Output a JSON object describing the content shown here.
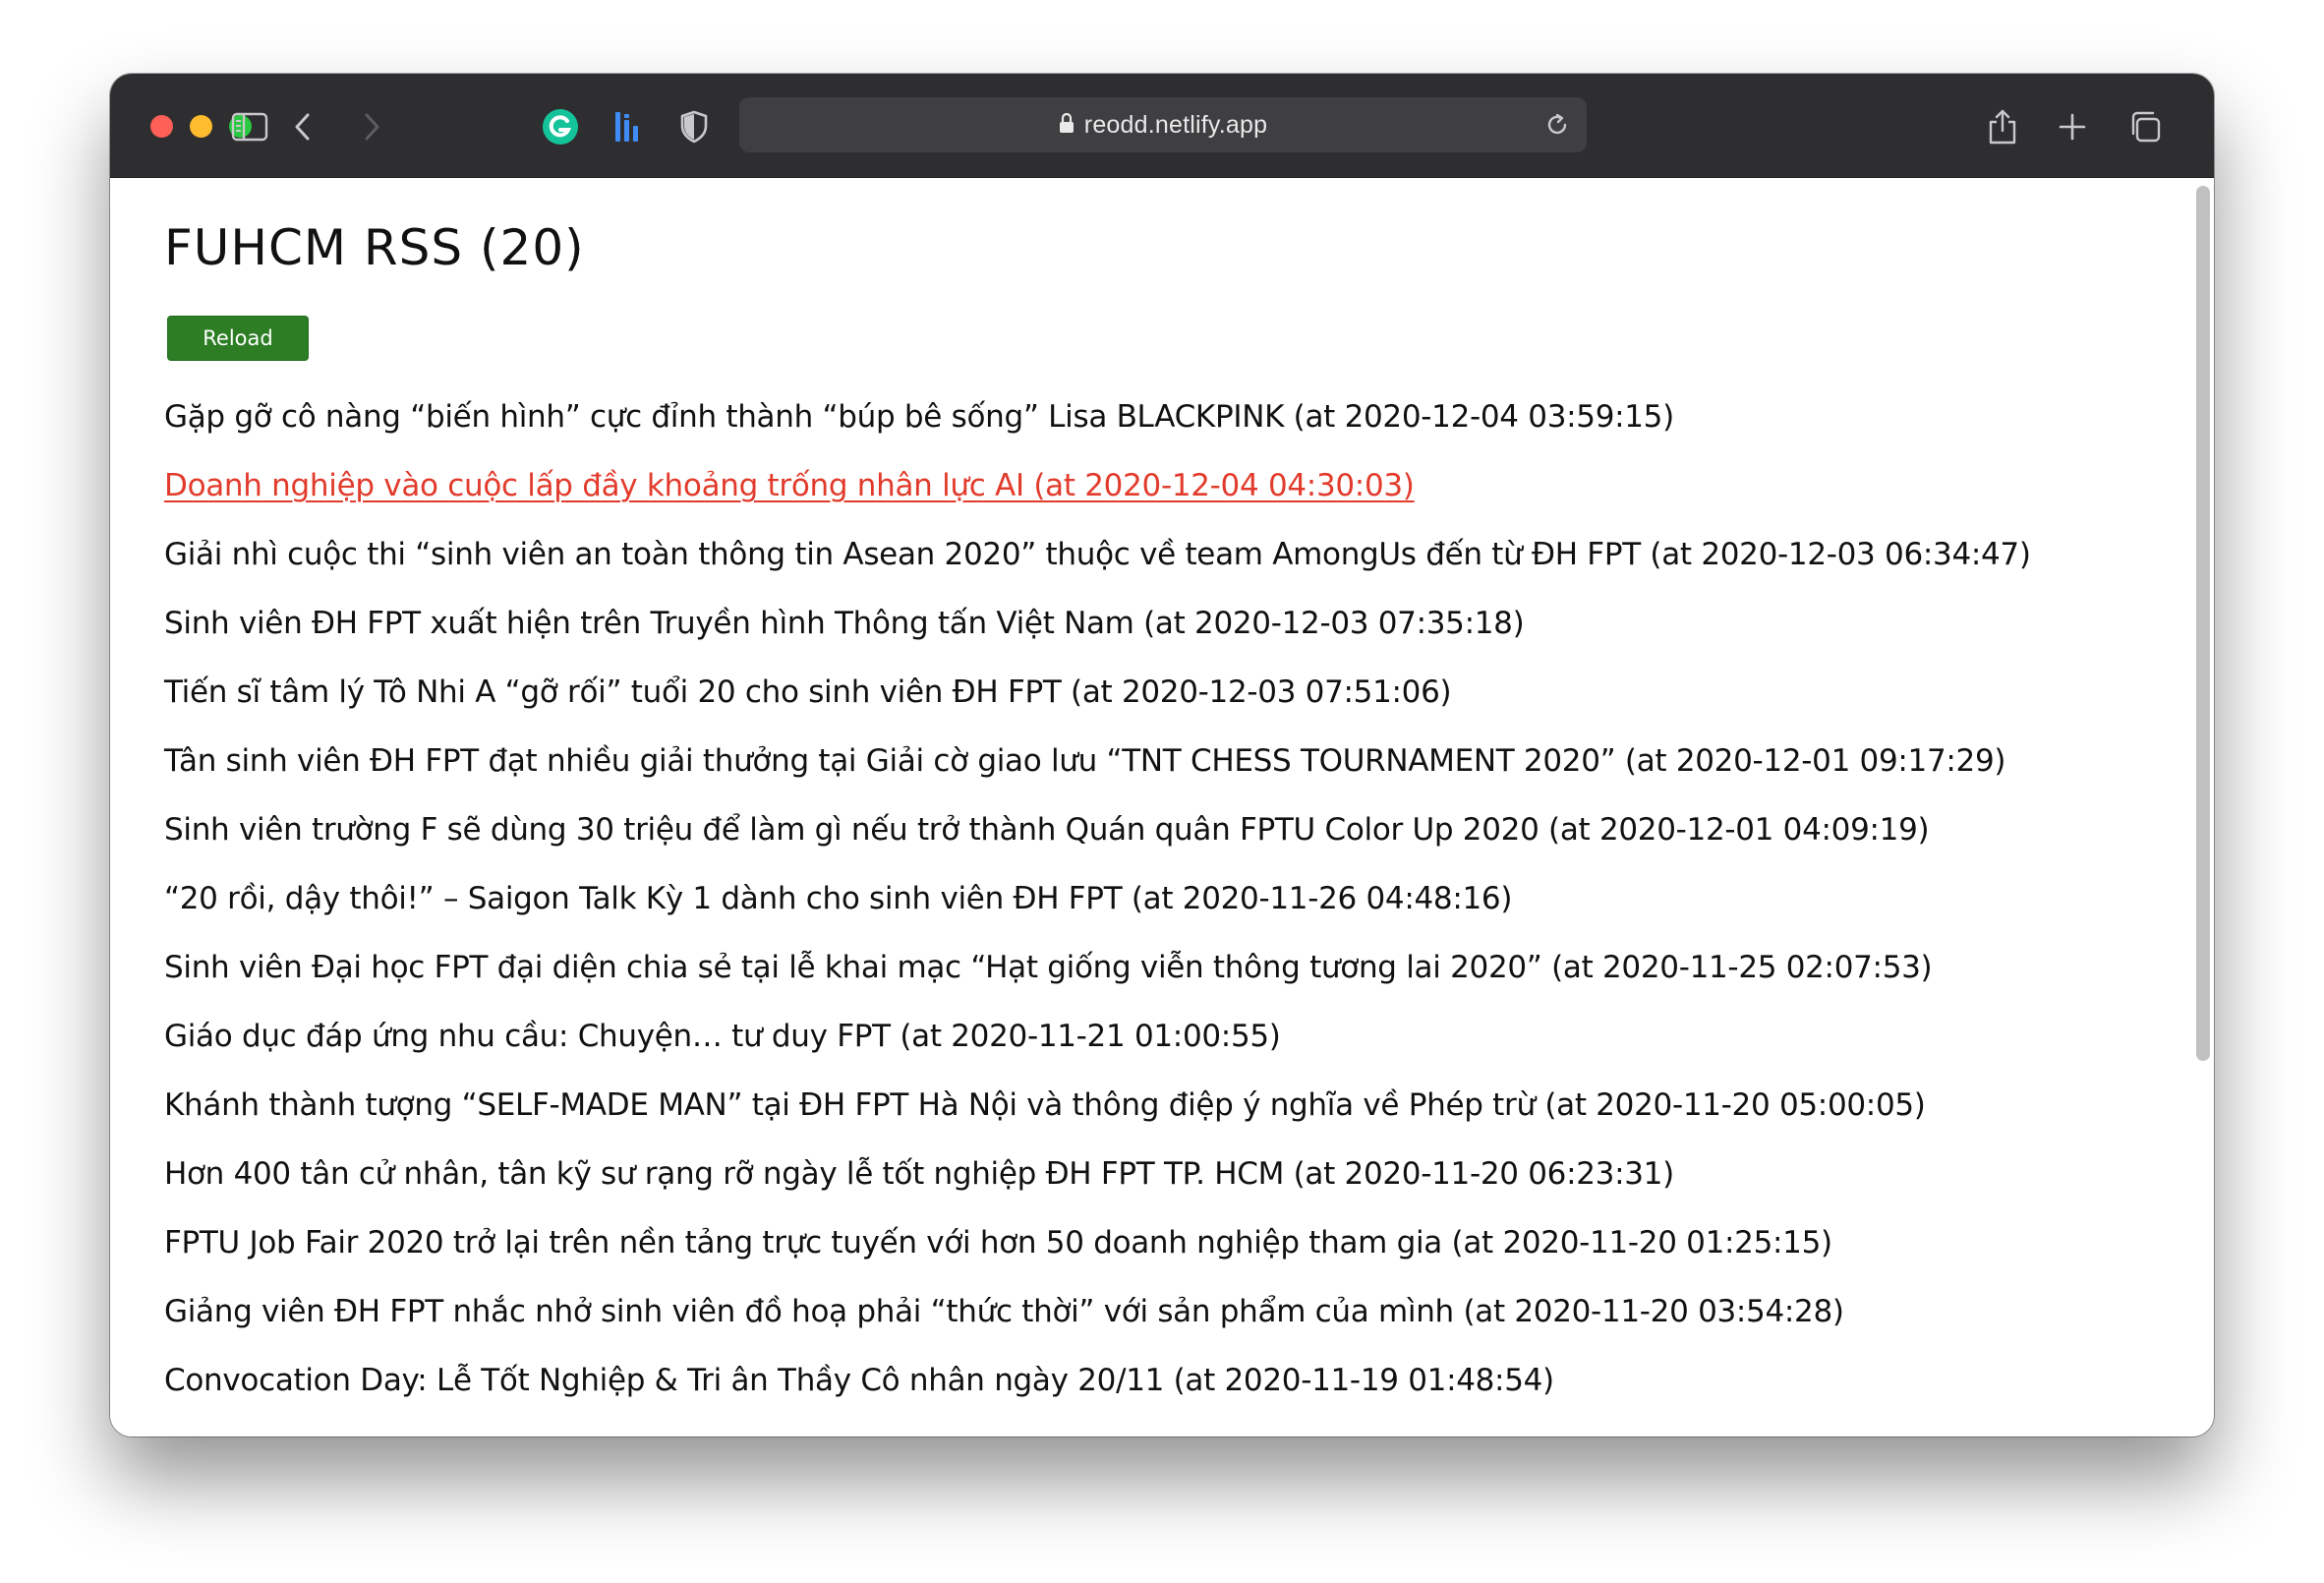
{
  "browser": {
    "url": "reodd.netlify.app",
    "icons": {
      "sidebar": "sidebar-icon",
      "back": "chevron-left-icon",
      "forward": "chevron-right-icon",
      "grammarly": "grammarly-icon",
      "extension": "bars-extension-icon",
      "privacy": "shield-icon",
      "lock": "lock-icon",
      "reload": "reload-icon",
      "share": "share-icon",
      "new_tab": "plus-icon",
      "tabs": "tabs-overview-icon"
    },
    "colors": {
      "toolbar": "#2e2e30",
      "close": "#fe5f57",
      "minimize": "#febc2e",
      "maximize": "#28c840"
    }
  },
  "page": {
    "title": "FUHCM RSS (20)",
    "reload_label": "Reload",
    "accent": "#2c7d24",
    "highlight_color": "#e23b2c",
    "items": [
      "Gặp gỡ cô nàng “biến hình” cực đỉnh thành “búp bê sống” Lisa BLACKPINK (at 2020-12-04 03:59:15)",
      "Doanh nghiệp vào cuộc lấp đầy khoảng trống nhân lực AI (at 2020-12-04 04:30:03)",
      "Giải nhì cuộc thi “sinh viên an toàn thông tin Asean 2020” thuộc về team AmongUs đến từ ĐH FPT (at 2020-12-03 06:34:47)",
      "Sinh viên ĐH FPT xuất hiện trên Truyền hình Thông tấn Việt Nam (at 2020-12-03 07:35:18)",
      "Tiến sĩ tâm lý Tô Nhi A “gỡ rối” tuổi 20 cho sinh viên ĐH FPT (at 2020-12-03 07:51:06)",
      "Tân sinh viên ĐH FPT đạt nhiều giải thưởng tại Giải cờ giao lưu “TNT CHESS TOURNAMENT 2020” (at 2020-12-01 09:17:29)",
      "Sinh viên trường F sẽ dùng 30 triệu để làm gì nếu trở thành Quán quân FPTU Color Up 2020 (at 2020-12-01 04:09:19)",
      "“20 rồi, dậy thôi!” – Saigon Talk Kỳ 1 dành cho sinh viên ĐH FPT (at 2020-11-26 04:48:16)",
      "Sinh viên Đại học FPT đại diện chia sẻ tại lễ khai mạc “Hạt giống viễn thông tương lai 2020” (at 2020-11-25 02:07:53)",
      "Giáo dục đáp ứng nhu cầu: Chuyện… tư duy FPT (at 2020-11-21 01:00:55)",
      "Khánh thành tượng “SELF-MADE MAN” tại ĐH FPT Hà Nội và thông điệp ý nghĩa về Phép trừ (at 2020-11-20 05:00:05)",
      "Hơn 400 tân cử nhân, tân kỹ sư rạng rỡ ngày lễ tốt nghiệp ĐH FPT TP. HCM (at 2020-11-20 06:23:31)",
      "FPTU Job Fair 2020 trở lại trên nền tảng trực tuyến với hơn 50 doanh nghiệp tham gia (at 2020-11-20 01:25:15)",
      "Giảng viên ĐH FPT nhắc nhở sinh viên đồ hoạ phải “thức thời” với sản phẩm của mình (at 2020-11-20 03:54:28)",
      "Convocation Day: Lễ Tốt Nghiệp & Tri ân Thầy Cô nhân ngày 20/11 (at 2020-11-19 01:48:54)"
    ]
  }
}
